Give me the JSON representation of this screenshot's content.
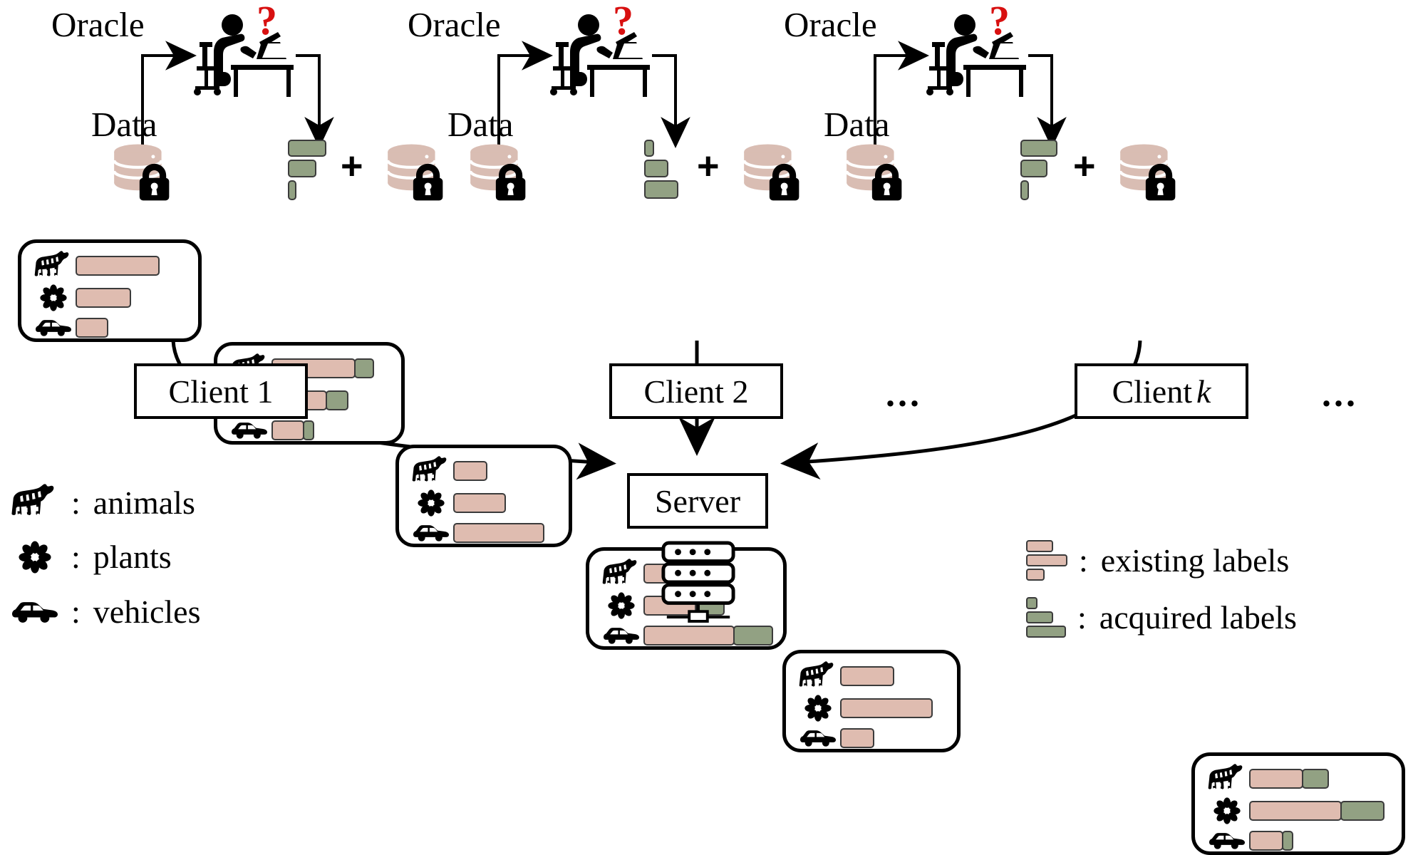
{
  "figure": {
    "type": "diagram",
    "title": "Federated active learning with oracle-annotated label acquisition"
  },
  "clients": [
    {
      "id": "client-1",
      "oracle_label": "Oracle",
      "data_label": "Data",
      "question_mark": "?",
      "box_label": "Client 1",
      "box_label_italic": "",
      "before": {
        "bars": [
          {
            "category": "animals",
            "icon": "zebra-icon",
            "existing": 118,
            "acquired": 0
          },
          {
            "category": "plants",
            "icon": "flower-icon",
            "existing": 78,
            "acquired": 0
          },
          {
            "category": "vehicles",
            "icon": "car-icon",
            "existing": 46,
            "acquired": 0
          }
        ]
      },
      "acquired_preview": [
        54,
        40,
        12
      ],
      "plus": "+",
      "after": {
        "bars": [
          {
            "category": "animals",
            "icon": "zebra-icon",
            "existing": 118,
            "acquired": 28
          },
          {
            "category": "plants",
            "icon": "flower-icon",
            "existing": 78,
            "acquired": 32
          },
          {
            "category": "vehicles",
            "icon": "car-icon",
            "existing": 46,
            "acquired": 16
          }
        ]
      }
    },
    {
      "id": "client-2",
      "oracle_label": "Oracle",
      "data_label": "Data",
      "question_mark": "?",
      "box_label": "Client 2",
      "box_label_italic": "",
      "before": {
        "bars": [
          {
            "category": "animals",
            "icon": "zebra-icon",
            "existing": 48,
            "acquired": 0
          },
          {
            "category": "plants",
            "icon": "flower-icon",
            "existing": 74,
            "acquired": 0
          },
          {
            "category": "vehicles",
            "icon": "car-icon",
            "existing": 128,
            "acquired": 0
          }
        ]
      },
      "acquired_preview": [
        14,
        34,
        48
      ],
      "plus": "+",
      "after": {
        "bars": [
          {
            "category": "animals",
            "icon": "zebra-icon",
            "existing": 48,
            "acquired": 14
          },
          {
            "category": "plants",
            "icon": "flower-icon",
            "existing": 74,
            "acquired": 42
          },
          {
            "category": "vehicles",
            "icon": "car-icon",
            "existing": 128,
            "acquired": 56
          }
        ]
      }
    },
    {
      "id": "client-k",
      "oracle_label": "Oracle",
      "data_label": "Data",
      "question_mark": "?",
      "box_label": "Client ",
      "box_label_italic": "k",
      "before": {
        "bars": [
          {
            "category": "animals",
            "icon": "zebra-icon",
            "existing": 76,
            "acquired": 0
          },
          {
            "category": "plants",
            "icon": "flower-icon",
            "existing": 130,
            "acquired": 0
          },
          {
            "category": "vehicles",
            "icon": "car-icon",
            "existing": 48,
            "acquired": 0
          }
        ]
      },
      "acquired_preview": [
        52,
        38,
        12
      ],
      "plus": "+",
      "after": {
        "bars": [
          {
            "category": "animals",
            "icon": "zebra-icon",
            "existing": 76,
            "acquired": 38
          },
          {
            "category": "plants",
            "icon": "flower-icon",
            "existing": 130,
            "acquired": 62
          },
          {
            "category": "vehicles",
            "icon": "car-icon",
            "existing": 48,
            "acquired": 16
          }
        ]
      }
    }
  ],
  "ellipsis": {
    "middle": "...",
    "right": "..."
  },
  "server": {
    "label": "Server",
    "icon": "server-rack-icon"
  },
  "legend_left": {
    "items": [
      {
        "icon": "zebra-icon",
        "colon": ":",
        "label": "animals"
      },
      {
        "icon": "flower-icon",
        "colon": ":",
        "label": "plants"
      },
      {
        "icon": "car-icon",
        "colon": ":",
        "label": "vehicles"
      }
    ]
  },
  "legend_right": {
    "items": [
      {
        "swatch": "existing-labels-swatch",
        "colon": ":",
        "label": "existing labels",
        "color": "#dfbcb0"
      },
      {
        "swatch": "acquired-labels-swatch",
        "colon": ":",
        "label": "acquired labels",
        "color": "#92a183"
      }
    ]
  },
  "colors": {
    "existing": "#dfbcb0",
    "acquired": "#92a183",
    "database": "#d9bdb3",
    "question": "#d81010",
    "stroke": "#000000"
  },
  "icons": {
    "oracle": "person-at-desk-icon",
    "data": "database-lock-icon"
  }
}
